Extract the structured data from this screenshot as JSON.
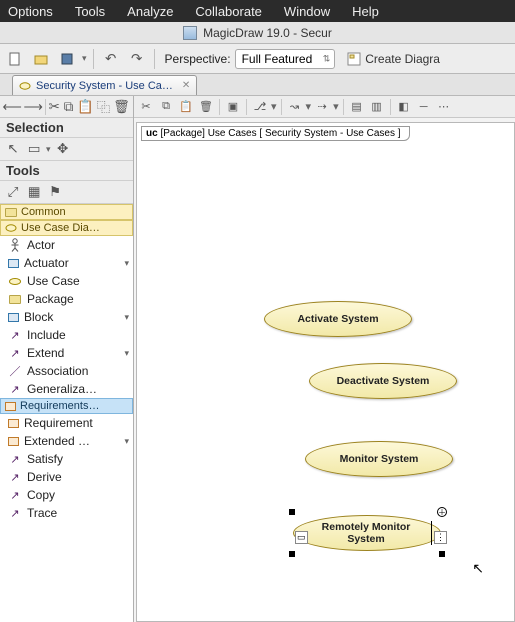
{
  "menubar": {
    "items": [
      "Options",
      "Tools",
      "Analyze",
      "Collaborate",
      "Window",
      "Help"
    ]
  },
  "titlebar": {
    "title": "MagicDraw 19.0 - Secur"
  },
  "toolbar": {
    "perspective_label": "Perspective:",
    "perspective_value": "Full Featured",
    "create_diagram": "Create Diagra"
  },
  "tab": {
    "label": "Security System - Use Ca…"
  },
  "left": {
    "selection_title": "Selection",
    "tools_title": "Tools",
    "groups": {
      "common": "Common",
      "usecase_diag": "Use Case Dia…",
      "requirements": "Requirements…"
    },
    "items": {
      "actor": "Actor",
      "actuator": "Actuator",
      "usecase": "Use Case",
      "package": "Package",
      "block": "Block",
      "include": "Include",
      "extend": "Extend",
      "association": "Association",
      "generaliza": "Generaliza…",
      "requirement": "Requirement",
      "extended": "Extended …",
      "satisfy": "Satisfy",
      "derive": "Derive",
      "copy": "Copy",
      "trace": "Trace"
    }
  },
  "diagram": {
    "frame_prefix": "uc",
    "frame_label": "[Package] Use Cases [ Security System - Use Cases ]",
    "ovals": {
      "activate": "Activate System",
      "deactivate": "Deactivate System",
      "monitor": "Monitor System",
      "remote": "Remotely Monitor System"
    }
  }
}
